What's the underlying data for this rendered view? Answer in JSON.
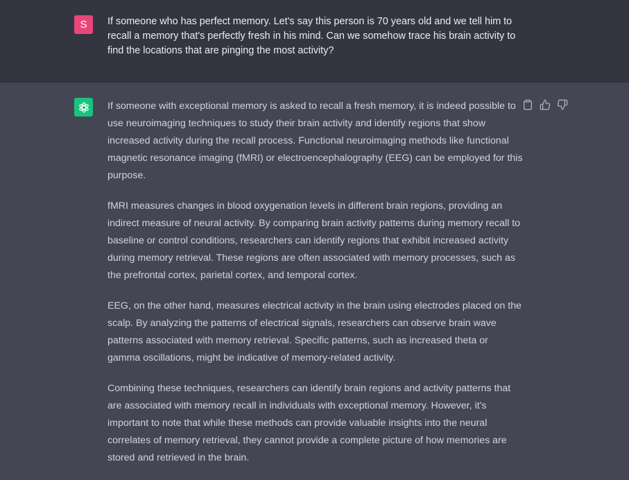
{
  "user_message": {
    "avatar_letter": "S",
    "text": "If someone who has perfect memory. Let's say this person is 70 years old and we tell him to recall a memory that's perfectly fresh in his mind. Can we somehow trace his brain activity to find the locations that are pinging the most activity?"
  },
  "assistant_message": {
    "paragraphs": [
      "If someone with exceptional memory is asked to recall a fresh memory, it is indeed possible to use neuroimaging techniques to study their brain activity and identify regions that show increased activity during the recall process. Functional neuroimaging methods like functional magnetic resonance imaging (fMRI) or electroencephalography (EEG) can be employed for this purpose.",
      "fMRI measures changes in blood oxygenation levels in different brain regions, providing an indirect measure of neural activity. By comparing brain activity patterns during memory recall to baseline or control conditions, researchers can identify regions that exhibit increased activity during memory retrieval. These regions are often associated with memory processes, such as the prefrontal cortex, parietal cortex, and temporal cortex.",
      "EEG, on the other hand, measures electrical activity in the brain using electrodes placed on the scalp. By analyzing the patterns of electrical signals, researchers can observe brain wave patterns associated with memory retrieval. Specific patterns, such as increased theta or gamma oscillations, might be indicative of memory-related activity.",
      "Combining these techniques, researchers can identify brain regions and activity patterns that are associated with memory recall in individuals with exceptional memory. However, it's important to note that while these methods can provide valuable insights into the neural correlates of memory retrieval, they cannot provide a complete picture of how memories are stored and retrieved in the brain."
    ]
  },
  "icons": {
    "user_avatar": "user-avatar",
    "assistant_avatar": "chatgpt-logo-icon",
    "copy": "clipboard-icon",
    "like": "thumbs-up-icon",
    "dislike": "thumbs-down-icon"
  },
  "colors": {
    "user_bg": "#343541",
    "assistant_bg": "#444654",
    "user_avatar": "#e8467a",
    "assistant_avatar": "#19c37d"
  }
}
